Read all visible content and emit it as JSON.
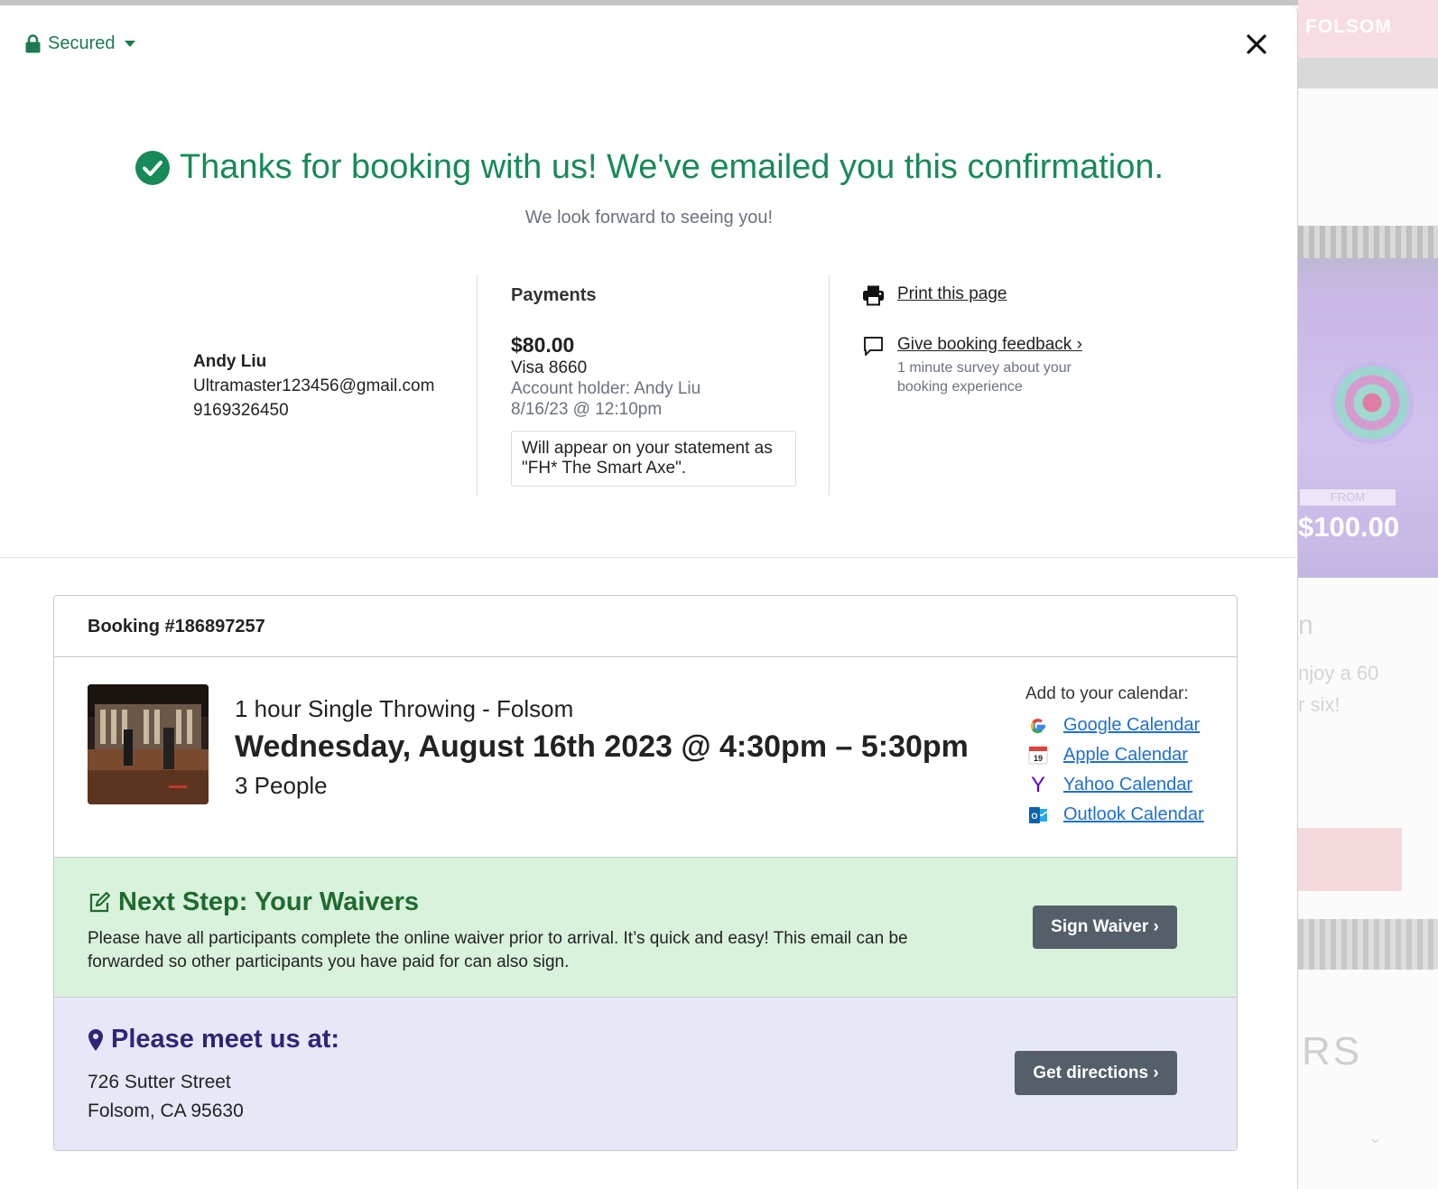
{
  "background": {
    "brand_fragment": "FOLSOM",
    "from_label": "FROM",
    "price": "$100.00",
    "text_fragment_1": "n",
    "text_fragment_2": "njoy a 60",
    "text_fragment_3": "r six!",
    "text_fragment_4": "RS"
  },
  "header": {
    "secured_label": "Secured",
    "lock_icon": "lock-icon",
    "close_icon": "close-icon"
  },
  "confirmation": {
    "headline": "Thanks for booking with us! We've emailed you this confirmation.",
    "subhead": "We look forward to seeing you!",
    "check_color": "#168a58"
  },
  "contact": {
    "name": "Andy Liu",
    "email": "Ultramaster123456@gmail.com",
    "phone": "9169326450"
  },
  "payments": {
    "title": "Payments",
    "amount": "$80.00",
    "card": "Visa 8660",
    "holder": "Account holder: Andy Liu",
    "datetime": "8/16/23 @ 12:10pm",
    "statement_note": "Will appear on your statement as \"FH* The Smart Axe\"."
  },
  "actions": {
    "print_label": "Print this page",
    "feedback_label": "Give booking feedback ›",
    "feedback_sub": "1 minute survey about your booking experience"
  },
  "booking": {
    "number_label": "Booking #186897257",
    "item_name": "1 hour Single Throwing - Folsom",
    "date_time": "Wednesday, August 16th 2023 @ 4:30pm – 5:30pm",
    "people": "3 People",
    "calendar": {
      "title": "Add to your calendar:",
      "items": [
        {
          "label": "Google Calendar",
          "icon": "google-icon"
        },
        {
          "label": "Apple Calendar",
          "icon": "apple-calendar-icon",
          "icon_text": "19"
        },
        {
          "label": "Yahoo Calendar",
          "icon": "yahoo-icon",
          "icon_text": "Y"
        },
        {
          "label": "Outlook Calendar",
          "icon": "outlook-icon",
          "icon_text": "O"
        }
      ]
    }
  },
  "waivers": {
    "title": "Next Step: Your Waivers",
    "description": "Please have all participants complete the online waiver prior to arrival. It’s quick and easy! This email can be forwarded so other participants you have paid for can also sign.",
    "button_label": "Sign Waiver ›",
    "bg_color": "#d9f2dc"
  },
  "location": {
    "title": "Please meet us at:",
    "street": "726 Sutter Street",
    "city": "Folsom, CA 95630",
    "button_label": "Get directions ›",
    "bg_color": "#e6e8f8"
  }
}
